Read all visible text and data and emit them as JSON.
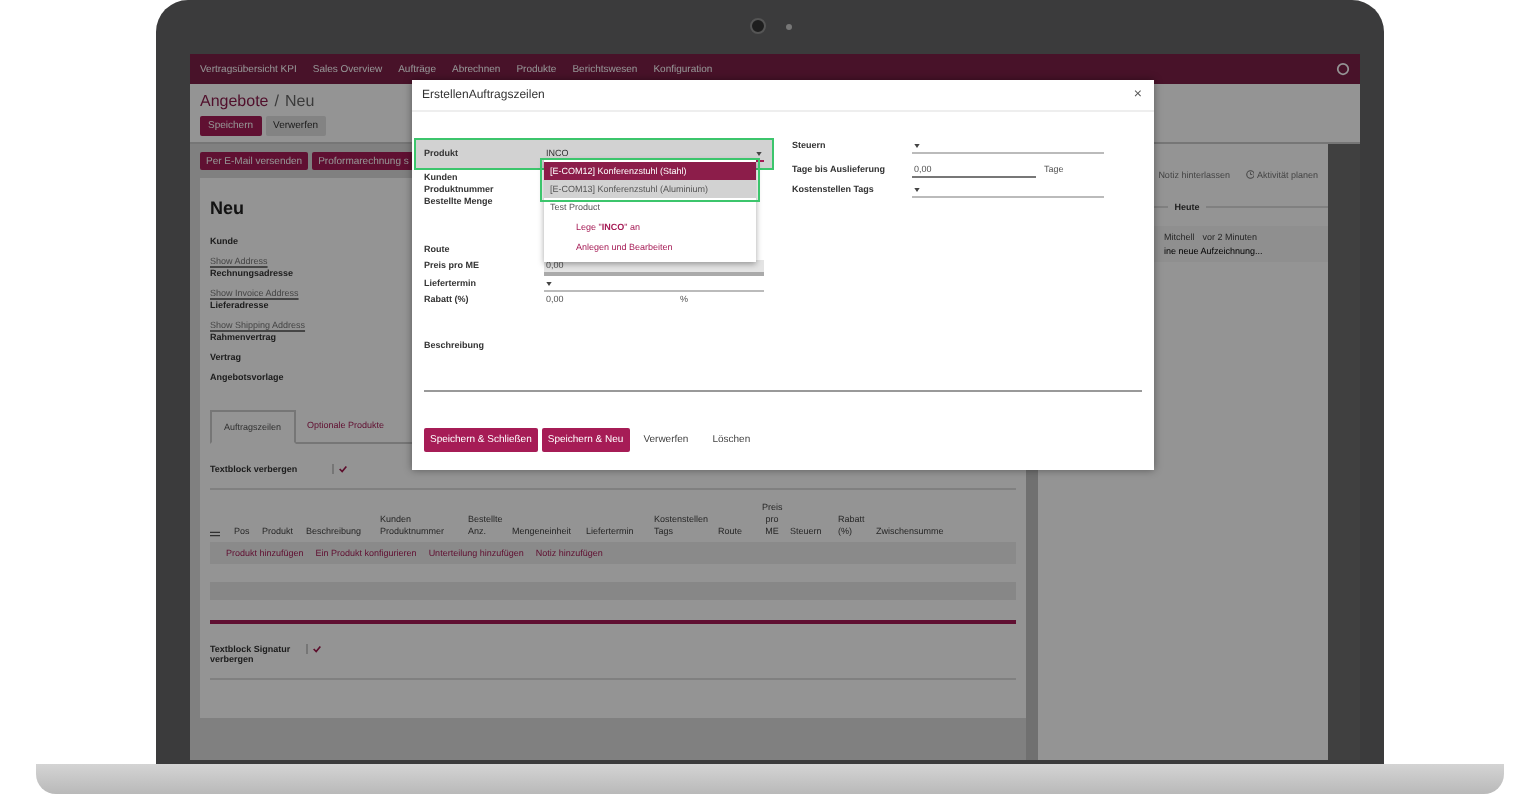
{
  "navbar": {
    "items": [
      "Vertragsübersicht KPI",
      "Sales Overview",
      "Aufträge",
      "Abrechnen",
      "Produkte",
      "Berichtswesen",
      "Konfiguration"
    ]
  },
  "breadcrumb": {
    "parent": "Angebote",
    "separator": "/",
    "current": "Neu"
  },
  "control_buttons": [
    {
      "label": "Speichern",
      "kind": "primary"
    },
    {
      "label": "Verwerfen",
      "kind": "secondary"
    }
  ],
  "action_buttons": [
    "Per E-Mail versenden",
    "Proformarechnung s"
  ],
  "form": {
    "title": "Neu",
    "fields": [
      {
        "label": "Kunde",
        "kind": "label"
      },
      {
        "label": "Show Address",
        "kind": "link"
      },
      {
        "label": "Rechnungsadresse",
        "kind": "label"
      },
      {
        "label": "Show Invoice Address",
        "kind": "link"
      },
      {
        "label": "Lieferadresse",
        "kind": "label"
      },
      {
        "label": "Show Shipping Address",
        "kind": "link"
      },
      {
        "label": "Rahmenvertrag",
        "kind": "label"
      },
      {
        "label": "Vertrag",
        "kind": "label"
      },
      {
        "label": "Angebotsvorlage",
        "kind": "label"
      }
    ]
  },
  "tabs": [
    {
      "label": "Auftragszeilen",
      "selected": true
    },
    {
      "label": "Optionale Produkte",
      "selected": false
    }
  ],
  "hide_textblock": {
    "label": "Textblock verbergen",
    "checked": true
  },
  "order_lines": {
    "columns": [
      "Pos",
      "Produkt",
      "Beschreibung",
      "Kunden Produktnummer",
      "Bestellte Anz.",
      "Mengeneinheit",
      "Liefertermin",
      "Kostenstellen Tags",
      "Route",
      "Preis pro ME",
      "Steuern",
      "Rabatt (%)",
      "Zwischensumme"
    ],
    "add_links": [
      "Produkt hinzufügen",
      "Ein Produkt konfigurieren",
      "Unterteilung hinzufügen",
      "Notiz hinzufügen"
    ]
  },
  "hide_signature": {
    "label": "Textblock Signatur verbergen",
    "checked": true
  },
  "chatter": {
    "actions": [
      "Notiz hinterlassen",
      "Aktivität planen"
    ],
    "date_separator": "Heute",
    "message": {
      "author": "Mitchell",
      "time": "vor 2 Minuten",
      "text": "ine neue Aufzeichnung..."
    }
  },
  "dialog": {
    "title": "ErstellenAuftragszeilen",
    "close": "×",
    "left_fields": [
      {
        "label": "Produkt",
        "kind": "select",
        "value": "INCO",
        "highlighted": true
      },
      {
        "label": "Kunden Produktnummer",
        "kind": "empty",
        "highlighted": false
      },
      {
        "label": "Bestellte Menge",
        "kind": "empty",
        "highlighted": false
      },
      {
        "label": "Route",
        "kind": "empty",
        "highlighted": false
      },
      {
        "label": "Preis pro ME",
        "kind": "input",
        "value": "0,00",
        "highlighted": false
      },
      {
        "label": "Liefertermin",
        "kind": "select",
        "highlighted": false
      },
      {
        "label": "Rabatt (%)",
        "kind": "input",
        "value": "0,00",
        "unit": "%",
        "highlighted": false
      }
    ],
    "right_fields": [
      {
        "label": "Steuern",
        "kind": "select"
      },
      {
        "label": "Tage bis Auslieferung",
        "kind": "input",
        "value": "0,00",
        "unit": "Tage"
      },
      {
        "label": "Kostenstellen Tags",
        "kind": "select"
      }
    ],
    "dropdown": {
      "options": [
        {
          "label": "[E-COM12] Konferenzstuhl (Stahl)",
          "kind": "product",
          "selected": true,
          "highlighted": true
        },
        {
          "label": "[E-COM13] Konferenzstuhl (Aluminium)",
          "kind": "product",
          "selected": false,
          "highlighted": true
        },
        {
          "label": "Test Product",
          "kind": "product",
          "selected": false,
          "highlighted": false
        },
        {
          "label": "Lege \"**INCO**\" an",
          "kind": "action",
          "selected": false,
          "highlighted": false
        },
        {
          "label": "Anlegen und Bearbeiten",
          "kind": "action",
          "selected": false,
          "highlighted": false
        }
      ]
    },
    "description_label": "Beschreibung",
    "buttons": [
      {
        "label": "Speichern & Schließen",
        "kind": "primary"
      },
      {
        "label": "Speichern & Neu",
        "kind": "primary"
      },
      {
        "label": "Verwerfen",
        "kind": "link"
      },
      {
        "label": "Löschen",
        "kind": "link"
      }
    ]
  }
}
